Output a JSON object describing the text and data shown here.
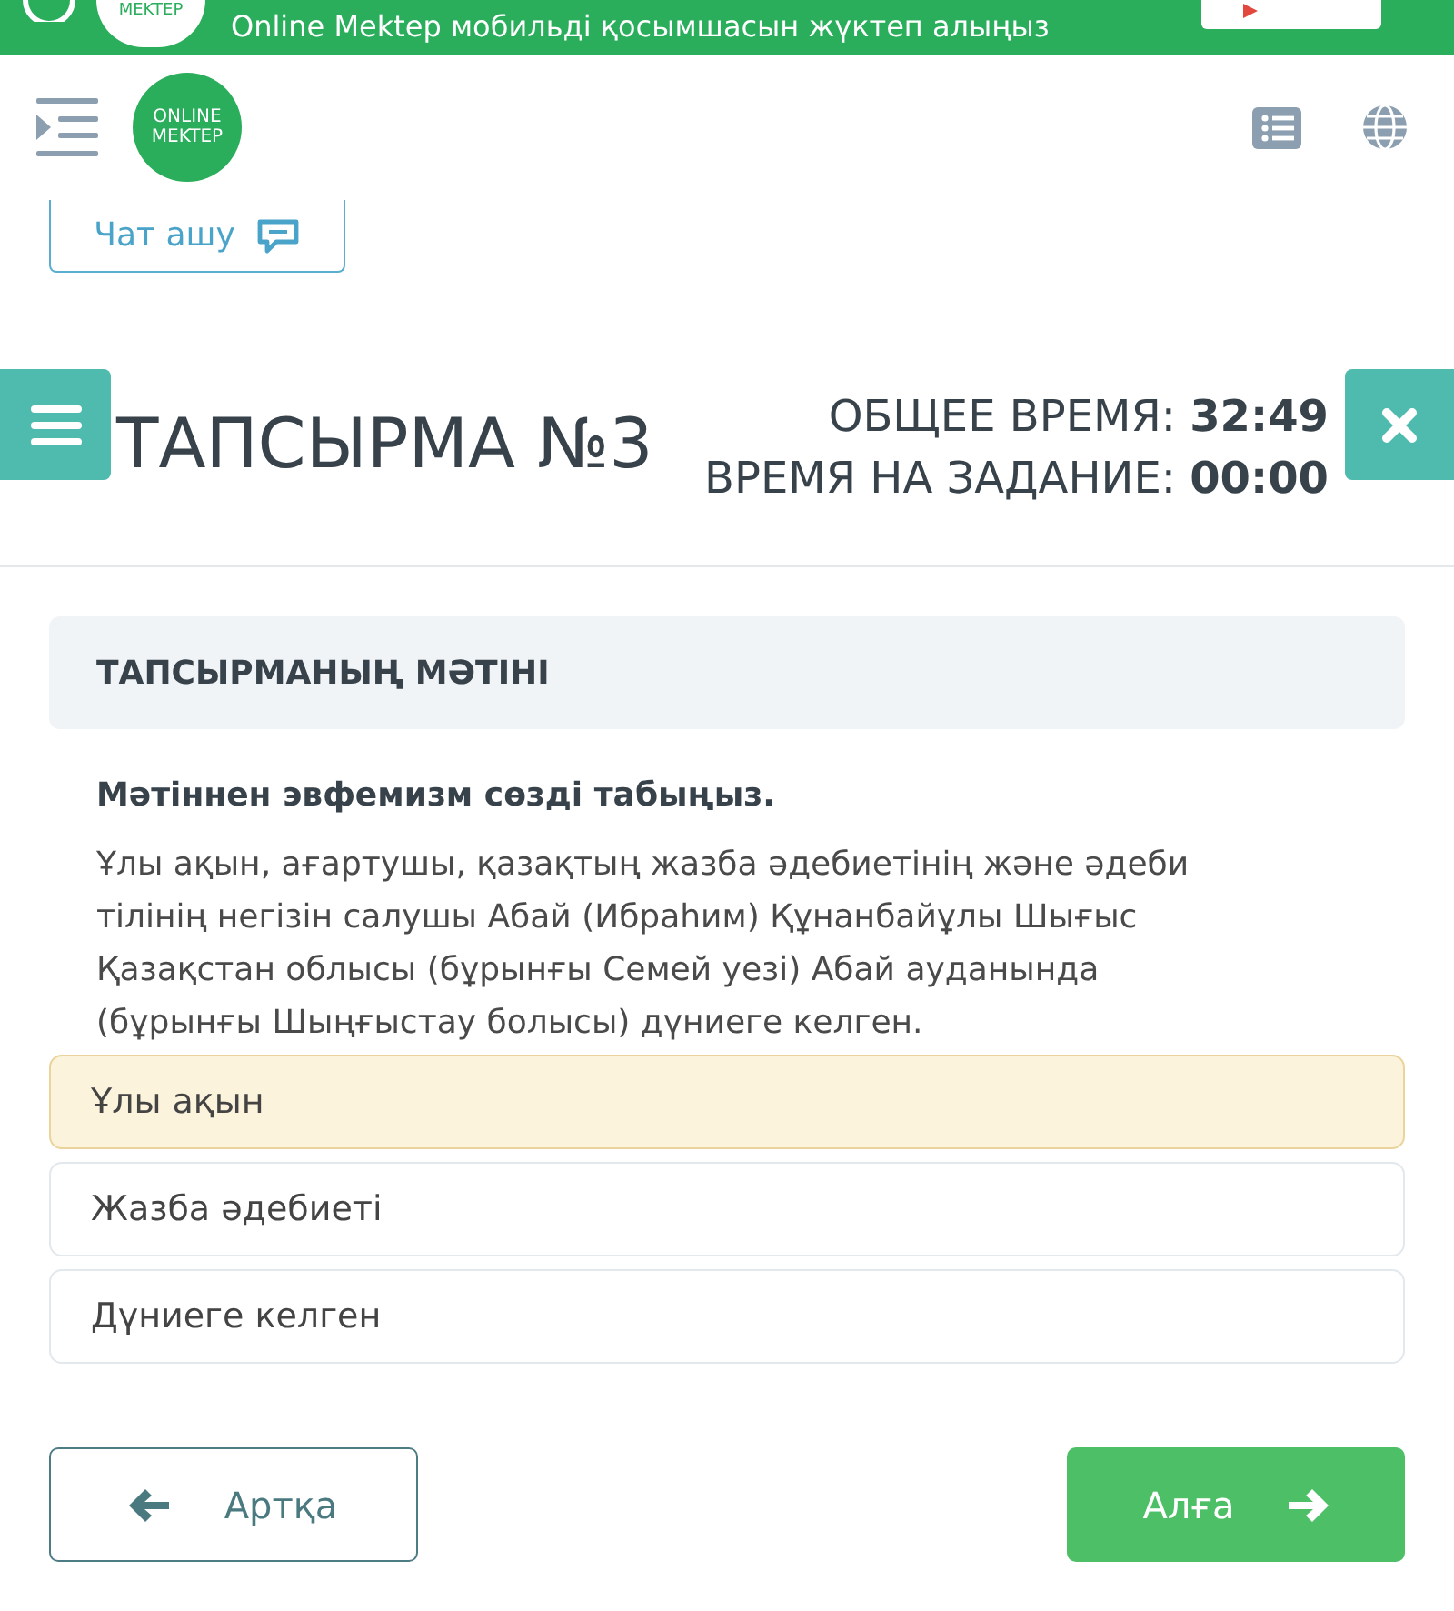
{
  "banner": {
    "logo_text": "MEKTEP",
    "text": "Online Mektep мобильді қосымшасын жүктеп алыңыз"
  },
  "header": {
    "logo_lines": [
      "ONLINE",
      "MEKTEP"
    ]
  },
  "chat_button": {
    "label": "Чат ашу"
  },
  "task": {
    "title": "ТАПСЫРМА №3",
    "timers": [
      "ОБЩЕЕ ВРЕМЯ: **32:49**",
      "ВРЕМЯ НА ЗАДАНИЕ: **00:00**"
    ]
  },
  "section": {
    "title": "ТАПСЫРМАНЫҢ МӘТІНІ",
    "question": "Мәтіннен эвфемизм сөзді табыңыз.",
    "text": "Ұлы ақын, ағартушы, қазақтың жазба әдебиетінің және әдеби тілінің негізін салушы Абай (Ибраһим) Құнанбайұлы Шығыс Қазақстан облысы (бұрынғы Семей уезі) Абай ауданында (бұрынғы Шыңғыстау болысы) дүниеге келген."
  },
  "options": [
    {
      "label": "Ұлы ақын",
      "selected": true
    },
    {
      "label": "Жазба әдебиеті",
      "selected": false
    },
    {
      "label": "Дүниеге келген",
      "selected": false
    }
  ],
  "nav": {
    "back": "Артқа",
    "next": "Алға"
  }
}
